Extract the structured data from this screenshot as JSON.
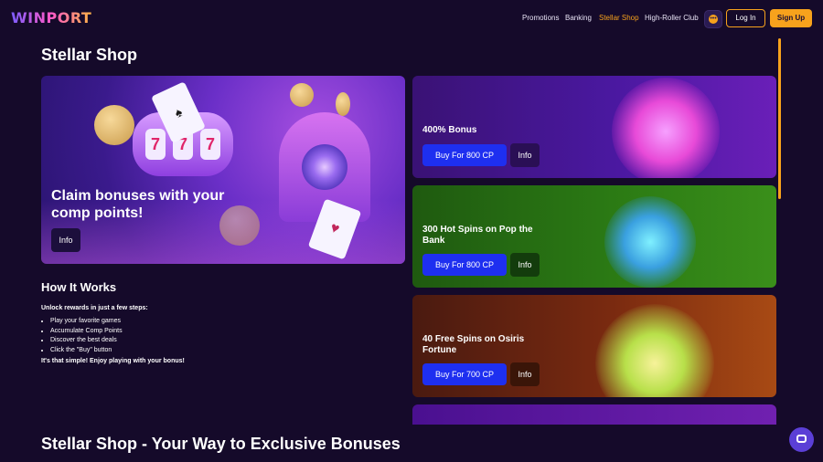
{
  "header": {
    "logo": "WINPORT",
    "nav": [
      {
        "label": "Promotions",
        "active": false
      },
      {
        "label": "Banking",
        "active": false
      },
      {
        "label": "Stellar Shop",
        "active": true
      },
      {
        "label": "High-Roller Club",
        "active": false
      }
    ],
    "login_label": "Log In",
    "signup_label": "Sign Up",
    "chat_icon": "chat-bubble-icon"
  },
  "page_title": "Stellar Shop",
  "hero": {
    "heading": "Claim bonuses with your comp points!",
    "info_label": "Info"
  },
  "how_it_works": {
    "heading": "How It Works",
    "intro": "Unlock rewards in just a few steps:",
    "steps": [
      "Play your favorite games",
      "Accumulate Comp Points",
      "Discover the best deals",
      "Click the \"Buy\" button"
    ],
    "outro": "It's that simple! Enjoy playing with your bonus!"
  },
  "offers": [
    {
      "title": "400% Bonus",
      "buy_label": "Buy For 800 CP",
      "info_label": "Info"
    },
    {
      "title": "300 Hot Spins on Pop the Bank",
      "buy_label": "Buy For 800 CP",
      "info_label": "Info"
    },
    {
      "title": "40 Free Spins on Osiris Fortune",
      "buy_label": "Buy For 700 CP",
      "info_label": "Info"
    }
  ],
  "bottom_heading": "Stellar Shop - Your Way to Exclusive Bonuses",
  "colors": {
    "background": "#150a2a",
    "accent": "#f7a21c",
    "buy_button": "#1e2ff0"
  }
}
